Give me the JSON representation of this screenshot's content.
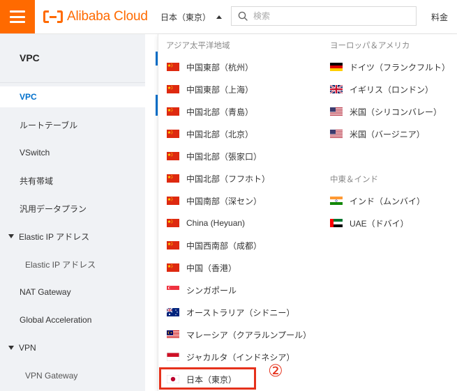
{
  "header": {
    "brand": "Alibaba Cloud",
    "region_selected": "日本（東京）",
    "search_placeholder": "検索",
    "billing_label": "料金"
  },
  "sidebar": {
    "title": "VPC",
    "items": [
      {
        "label": "VPC",
        "active": true
      },
      {
        "label": "ルートテーブル"
      },
      {
        "label": "VSwitch"
      },
      {
        "label": "共有帯域"
      },
      {
        "label": "汎用データプラン"
      },
      {
        "label": "Elastic IP アドレス",
        "expandable": true
      },
      {
        "label": "Elastic IP アドレス",
        "sub": true
      },
      {
        "label": "NAT Gateway"
      },
      {
        "label": "Global Acceleration"
      },
      {
        "label": "VPN",
        "expandable": true
      },
      {
        "label": "VPN Gateway",
        "sub": true
      }
    ]
  },
  "region_dropdown": {
    "groups": [
      {
        "title": "アジア太平洋地域",
        "regions": [
          {
            "label": "中国東部（杭州）",
            "flag": "china-flag-icon"
          },
          {
            "label": "中国東部（上海）",
            "flag": "china-flag-icon"
          },
          {
            "label": "中国北部（青島）",
            "flag": "china-flag-icon"
          },
          {
            "label": "中国北部（北京）",
            "flag": "china-flag-icon"
          },
          {
            "label": "中国北部（張家口）",
            "flag": "china-flag-icon"
          },
          {
            "label": "中国北部（フフホト）",
            "flag": "china-flag-icon"
          },
          {
            "label": "中国南部（深セン）",
            "flag": "china-flag-icon"
          },
          {
            "label": "China (Heyuan)",
            "flag": "china-flag-icon"
          },
          {
            "label": "中国西南部（成都）",
            "flag": "china-flag-icon"
          },
          {
            "label": "中国（香港）",
            "flag": "china-flag-icon"
          },
          {
            "label": "シンガポール",
            "flag": "singapore-flag-icon"
          },
          {
            "label": "オーストラリア（シドニー）",
            "flag": "australia-flag-icon"
          },
          {
            "label": "マレーシア（クアラルンプール）",
            "flag": "malaysia-flag-icon"
          },
          {
            "label": "ジャカルタ（インドネシア）",
            "flag": "indonesia-flag-icon"
          },
          {
            "label": "日本（東京）",
            "flag": "japan-flag-icon",
            "selected": true
          }
        ]
      },
      {
        "title": "ヨーロッパ＆アメリカ",
        "regions": [
          {
            "label": "ドイツ（フランクフルト）",
            "flag": "germany-flag-icon"
          },
          {
            "label": "イギリス（ロンドン）",
            "flag": "uk-flag-icon"
          },
          {
            "label": "米国（シリコンバレー）",
            "flag": "us-flag-icon"
          },
          {
            "label": "米国（バージニア）",
            "flag": "us-flag-icon"
          }
        ]
      },
      {
        "title": "中東＆インド",
        "regions": [
          {
            "label": "インド（ムンバイ）",
            "flag": "india-flag-icon"
          },
          {
            "label": "UAE（ドバイ）",
            "flag": "uae-flag-icon"
          }
        ]
      }
    ]
  },
  "annotation": {
    "step_marker": "②",
    "highlight_color": "#e5311b"
  },
  "colors": {
    "brand": "#ff6a00",
    "active_link": "#0070cc"
  }
}
